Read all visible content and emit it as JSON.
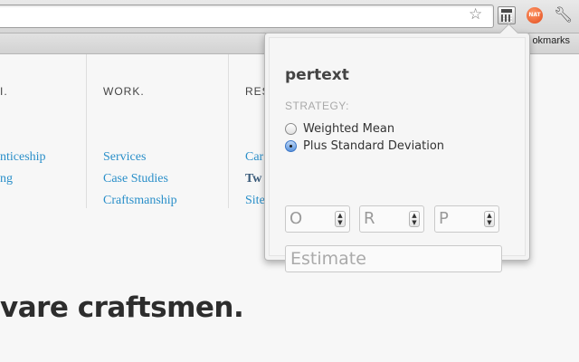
{
  "browser": {
    "bookmarks_label": "okmarks",
    "icons": {
      "star": "star-icon",
      "calculator": "calculator-icon",
      "avatar": "avatar-icon",
      "wrench": "wrench-icon"
    },
    "avatar_text": "NAT"
  },
  "page": {
    "columns": [
      {
        "heading": "...",
        "links": [
          "nticeship",
          "ng"
        ]
      },
      {
        "heading": "WORK.",
        "links": [
          "Services",
          "Case Studies",
          "Craftsmanship"
        ]
      },
      {
        "heading": "RES",
        "links": [
          "Car",
          "Tw",
          "Site"
        ]
      }
    ],
    "headline": "vare craftsmen."
  },
  "popup": {
    "title": "pertext",
    "strategy_label": "STRATEGY:",
    "options": [
      {
        "label": "Weighted Mean",
        "checked": false
      },
      {
        "label": "Plus Standard Deviation",
        "checked": true
      }
    ],
    "fields": [
      {
        "placeholder": "O"
      },
      {
        "placeholder": "R"
      },
      {
        "placeholder": "P"
      }
    ],
    "estimate_placeholder": "Estimate"
  },
  "colors": {
    "link": "#2a8fc9",
    "radio_checked": "#3b76c6"
  }
}
